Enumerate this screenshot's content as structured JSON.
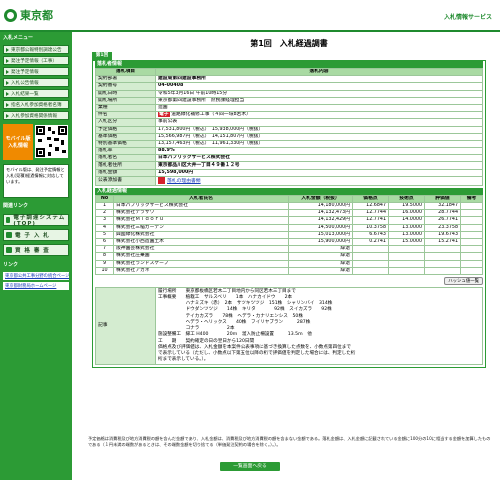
{
  "header": {
    "logo_text": "東京都",
    "service_name": "入札情報サービス"
  },
  "sidebar": {
    "menu_head": "入札メニュー",
    "menu_items": [
      "東京都公報特別調達公告",
      "発注予定情報（工事）",
      "発注予定情報",
      "入札公告情報",
      "入札結果一覧",
      "指名入札参加資格者名簿",
      "入札参加資格関係情報"
    ],
    "mobile_label_1": "モバイル版",
    "mobile_label_2": "入札情報",
    "mobile_note": "モバイル版は、発注予定情報と入札(見積)経過情報に対応しています。",
    "other_head": "関連リンク",
    "big_buttons": [
      "電子調達システム(TOP)",
      "電 子 入 札",
      "資 格 審 査"
    ],
    "link_head": "リンク",
    "links": [
      "東京都公共工事分野の統合ページ",
      "東京都財務局ホームページ"
    ]
  },
  "main": {
    "title": "第1回　入札経過調書",
    "round_tab": "第1回",
    "contract_section": "落札者情報",
    "contract_header": {
      "item": "落札項目",
      "content": "落札内容"
    },
    "rows": [
      {
        "label": "契約部署",
        "value": "建設局第四建設事務所",
        "bold": true
      },
      {
        "label": "契約番号",
        "value": "04-00408",
        "bold": true
      },
      {
        "label": "開札日時",
        "value": "令和5年3月16日 午前10時15分"
      },
      {
        "label": "開札場所",
        "value": "東京都第四建設事務所　庶務課経理担当"
      },
      {
        "label": "業種",
        "value": "造園"
      },
      {
        "label": "件名",
        "value": "道路緑化補修工事（４四一環8若木）",
        "tag": "電子"
      },
      {
        "label": "入札区分",
        "value": "事前公表"
      },
      {
        "label": "予定価格",
        "value": "17,531,800円（税込）　15,938,000円（税抜）"
      },
      {
        "label": "基準価格",
        "value": "15,566,987円（税込）　14,151,807円（税抜）"
      },
      {
        "label": "特別基準価格",
        "value": "13,157,463円（税込）　11,961,330円（税抜）"
      },
      {
        "label": "落札率",
        "value": "88.9%",
        "bold": true
      },
      {
        "label": "落札者名",
        "value": "日本パブリックサービス株式会社",
        "bold": true
      },
      {
        "label": "落札者住所",
        "value": "東京都品川区大井一丁目４９番１２号",
        "bold": true
      },
      {
        "label": "落札金額",
        "value": "15,598,000円",
        "bold": true
      },
      {
        "label": "公表添加書",
        "value": "落札の理由書類"
      }
    ],
    "bid_section": "入札経過情報",
    "bid_header": [
      "No",
      "入札者氏名",
      "入札金額（税抜）",
      "価格点",
      "技術点",
      "評価値",
      "備考"
    ],
    "bids": [
      {
        "no": "1",
        "name": "日本パブリックサービス株式会社",
        "amount": "14,180,000円",
        "price": "12.6847",
        "tech": "19.5000",
        "score": "32.1847",
        "note": ""
      },
      {
        "no": "2",
        "name": "株式会社テラサワ",
        "amount": "14,132,473円",
        "price": "12.7744",
        "tech": "16.0000",
        "score": "28.7744",
        "note": ""
      },
      {
        "no": "3",
        "name": "株式会社Ｍｉｄｏｒｕ",
        "amount": "14,132,429円",
        "price": "12.7741",
        "tech": "14.0000",
        "score": "26.7741",
        "note": ""
      },
      {
        "no": "4",
        "name": "株式会社三稲ガーデン",
        "amount": "14,500,000円",
        "price": "10.3758",
        "tech": "13.0000",
        "score": "23.3758",
        "note": ""
      },
      {
        "no": "5",
        "name": "興國緑化株式会社",
        "amount": "15,013,000円",
        "price": "6.6743",
        "tech": "13.0000",
        "score": "19.6743",
        "note": ""
      },
      {
        "no": "6",
        "name": "株式会社小西造園土木",
        "amount": "15,900,000円",
        "price": "0.2741",
        "tech": "15.0000",
        "score": "15.2741",
        "note": ""
      },
      {
        "no": "7",
        "name": "阪神園芸株式会社",
        "amount": "辞退",
        "price": "",
        "tech": "",
        "score": "",
        "note": ""
      },
      {
        "no": "8",
        "name": "株式会社庄乗園",
        "amount": "辞退",
        "price": "",
        "tech": "",
        "score": "",
        "note": ""
      },
      {
        "no": "9",
        "name": "株式会社ランドスケープ",
        "amount": "辞退",
        "price": "",
        "tech": "",
        "score": "",
        "note": ""
      },
      {
        "no": "10",
        "name": "株式会社アカネ",
        "amount": "辞退",
        "price": "",
        "tech": "",
        "score": "",
        "note": ""
      }
    ],
    "hash_button": "ハッシュ値一覧",
    "remark_label": "記事",
    "remark_text": "履行場所　　東京都板橋区若木二丁目地内から同区若木三丁目まで\n工事概要　　植栽工　サルスベリ　　1本　ハナカイドウ　　2本\n　　　　　　ハナミズキ（赤）　2本　サツキツツジ　151株　シャリンバイ　314株\n　　　　　　ドウダンツツジ　　14株　キリタ　　　　92株　スイカズラ　　92株\n　　　　　　テイカカズラ　　78株　ヘデラ・カナリエンシス　50株\n　　　　　　ヘデラ・ヘリックス　　40株　フイリヤブラン　　　287株\n　　　　　　コナラ　　　　　　2本\n施設整備工　縁工 H400　　　　20ｍ　溜入防止柵設置　　　13.5ｍ　他\n工　　期　　契約確定の日の翌日から120日間\n価格点及び評価値は、入札金額を本案件公表事項に基づき換算した点数を、小数点第四位まで\nで表示している（ただし、小数点以下第五位以降の桁で評価値を判定した場合には、判定した桁\n桁まで表示している。）。"
  },
  "footnote": "予定価格は消費税及び地方消費税の額を含んだ金額であり、入札金額は、消費税及び地方消費税の額を含まない金額である。落札金額は、入札金額に記載されている金額に100分の10に相当する金額を加算したものである（１円未満の端数があるときは、その端数金額を切り捨てる（単価発注契約の場合を除く。）。）。",
  "back_button": "一覧画面へ戻る",
  "colors": {
    "brand_green": "#2c9b35",
    "header_row": "#a9daa3",
    "label_cell": "#d4ecd0",
    "mobile_orange": "#f08a00",
    "tag_red": "#d4202b"
  }
}
